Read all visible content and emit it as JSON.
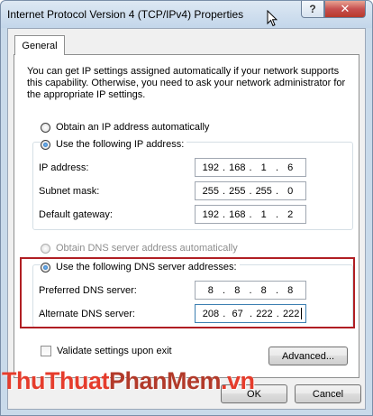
{
  "window": {
    "title": "Internet Protocol Version 4 (TCP/IPv4) Properties",
    "help_label": "?",
    "close_label": "✕"
  },
  "tabs": [
    {
      "label": "General"
    }
  ],
  "description": "You can get IP settings assigned automatically if your network supports this capability. Otherwise, you need to ask your network administrator for the appropriate IP settings.",
  "ip": {
    "auto_label": "Obtain an IP address automatically",
    "manual_label": "Use the following IP address:",
    "selected": "manual",
    "fields": [
      {
        "label": "IP address:",
        "octets": [
          "192",
          "168",
          "1",
          "6"
        ]
      },
      {
        "label": "Subnet mask:",
        "octets": [
          "255",
          "255",
          "255",
          "0"
        ]
      },
      {
        "label": "Default gateway:",
        "octets": [
          "192",
          "168",
          "1",
          "2"
        ]
      }
    ]
  },
  "dns": {
    "auto_label": "Obtain DNS server address automatically",
    "manual_label": "Use the following DNS server addresses:",
    "selected": "manual",
    "fields": [
      {
        "label": "Preferred DNS server:",
        "octets": [
          "8",
          "8",
          "8",
          "8"
        ]
      },
      {
        "label": "Alternate DNS server:",
        "octets": [
          "208",
          "67",
          "222",
          "222"
        ]
      }
    ]
  },
  "validate_label": "Validate settings upon exit",
  "buttons": {
    "advanced": "Advanced...",
    "ok": "OK",
    "cancel": "Cancel"
  },
  "watermark": {
    "part1": "ThuThuat",
    "part2": "PhanMem",
    "part3": ".vn"
  },
  "colors": {
    "highlight_border": "#b01e23",
    "watermark_red": "#e53c2c"
  }
}
